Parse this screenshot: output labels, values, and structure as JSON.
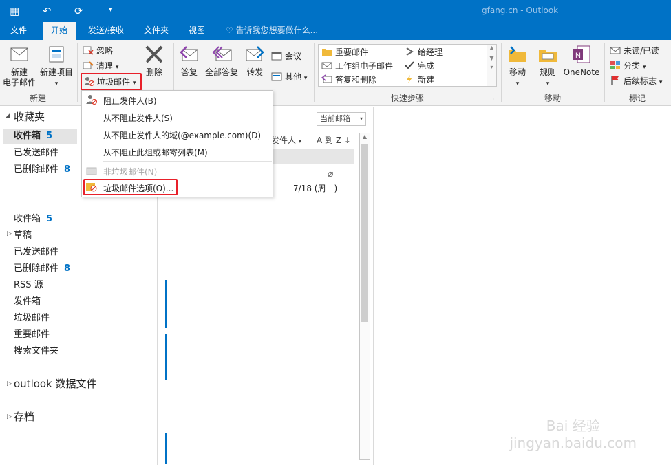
{
  "title": "gfang.cn - Outlook",
  "tabs": [
    "文件",
    "开始",
    "发送/接收",
    "文件夹",
    "视图"
  ],
  "tell_me": "告诉我您想要做什么...",
  "ribbon": {
    "new_email": "新建\n电子邮件",
    "new_items": "新建项目",
    "group_new": "新建",
    "ignore": "忽略",
    "cleanup": "清理",
    "junk": "垃圾邮件",
    "delete": "删除",
    "reply": "答复",
    "reply_all": "全部答复",
    "forward": "转发",
    "meeting": "会议",
    "more": "其他",
    "quick_steps": [
      "重要邮件",
      "给经理",
      "工作组电子邮件",
      "完成",
      "答复和删除",
      "新建"
    ],
    "group_quick_steps": "快速步骤",
    "move": "移动",
    "rules": "规则",
    "onenote": "OneNote",
    "group_move": "移动",
    "unread_read": "未读/已读",
    "categorize": "分类",
    "follow_up": "后续标志",
    "group_tags": "标记"
  },
  "nav": {
    "favorites": "收藏夹",
    "fav_items": [
      {
        "label": "收件箱",
        "count": "5"
      },
      {
        "label": "已发送邮件",
        "count": ""
      },
      {
        "label": "已删除邮件",
        "count": "8"
      }
    ],
    "folders": [
      {
        "label": "收件箱",
        "count": "5"
      },
      {
        "label": "草稿",
        "count": ""
      },
      {
        "label": "已发送邮件",
        "count": ""
      },
      {
        "label": "已删除邮件",
        "count": "8"
      },
      {
        "label": "RSS 源",
        "count": ""
      },
      {
        "label": "发件箱",
        "count": ""
      },
      {
        "label": "垃圾邮件",
        "count": ""
      },
      {
        "label": "重要邮件",
        "count": ""
      },
      {
        "label": "搜索文件夹",
        "count": ""
      }
    ],
    "data_file": "outlook 数据文件",
    "archive": "存档"
  },
  "list": {
    "scope": "当前邮箱",
    "sort_by": "发件人",
    "order": "A 到 Z",
    "date": "7/18 (周一)"
  },
  "menu": {
    "items": [
      "阻止发件人(B)",
      "从不阻止发件人(S)",
      "从不阻止发件人的域(@example.com)(D)",
      "从不阻止此组或邮寄列表(M)",
      "非垃圾邮件(N)",
      "垃圾邮件选项(O)..."
    ]
  },
  "watermark": "Bai 经验\njingyan.baidu.com",
  "colors": {
    "accent": "#0072c6",
    "highlight": "#e8202a"
  }
}
